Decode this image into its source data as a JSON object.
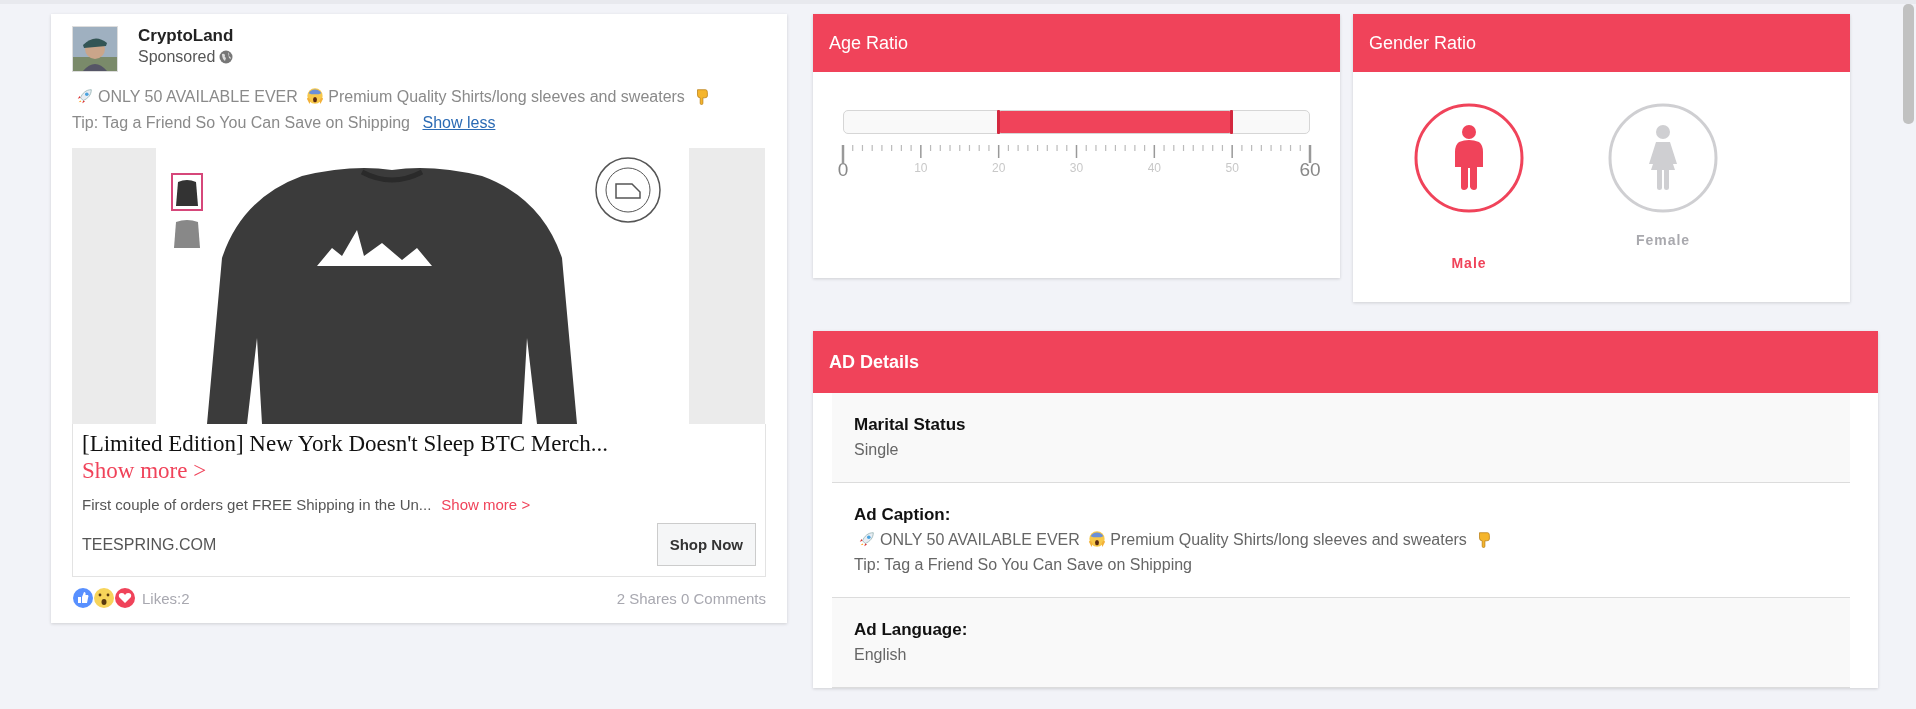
{
  "post": {
    "page_name": "CryptoLand",
    "sponsored_label": "Sponsored",
    "caption": [
      "ONLY 50 AVAILABLE EVER",
      "Premium Quality Shirts/long sleeves and sweaters",
      "Tip: Tag a Friend So You Can Save on Shipping"
    ],
    "show_less": "Show less",
    "link_title": "[Limited Edition] New York Doesn't Sleep BTC Merch...",
    "link_title_more": "Show more >",
    "link_description": "First couple of orders get FREE Shipping in the Un...",
    "link_description_more": "Show more >",
    "domain": "TEESPRING.COM",
    "cta": "Shop Now",
    "likes": "Likes:2",
    "stats": "2 Shares 0 Comments"
  },
  "age_ratio": {
    "title": "Age Ratio",
    "range": {
      "low": {
        "level": 0.3333
      },
      "high": {
        "level": 0.8333
      }
    },
    "tick_labels": [
      "0",
      "10",
      "20",
      "30",
      "40",
      "50",
      "60"
    ]
  },
  "gender_ratio": {
    "title": "Gender Ratio",
    "options": [
      {
        "kind": "male",
        "label": "Male",
        "selected": true
      },
      {
        "kind": "female",
        "label": "Female",
        "selected": false
      }
    ]
  },
  "ad_details": {
    "title": "AD Details",
    "rows": [
      {
        "kind": "text",
        "label": "Marital Status",
        "value": "Single"
      },
      {
        "kind": "caption",
        "label": "Ad Caption:",
        "parts": [
          "ONLY 50 AVAILABLE EVER",
          "Premium Quality Shirts/long sleeves and sweaters",
          "Tip: Tag a Friend So You Can Save on Shipping"
        ]
      },
      {
        "kind": "text",
        "label": "Ad Language:",
        "value": "English"
      }
    ]
  }
}
